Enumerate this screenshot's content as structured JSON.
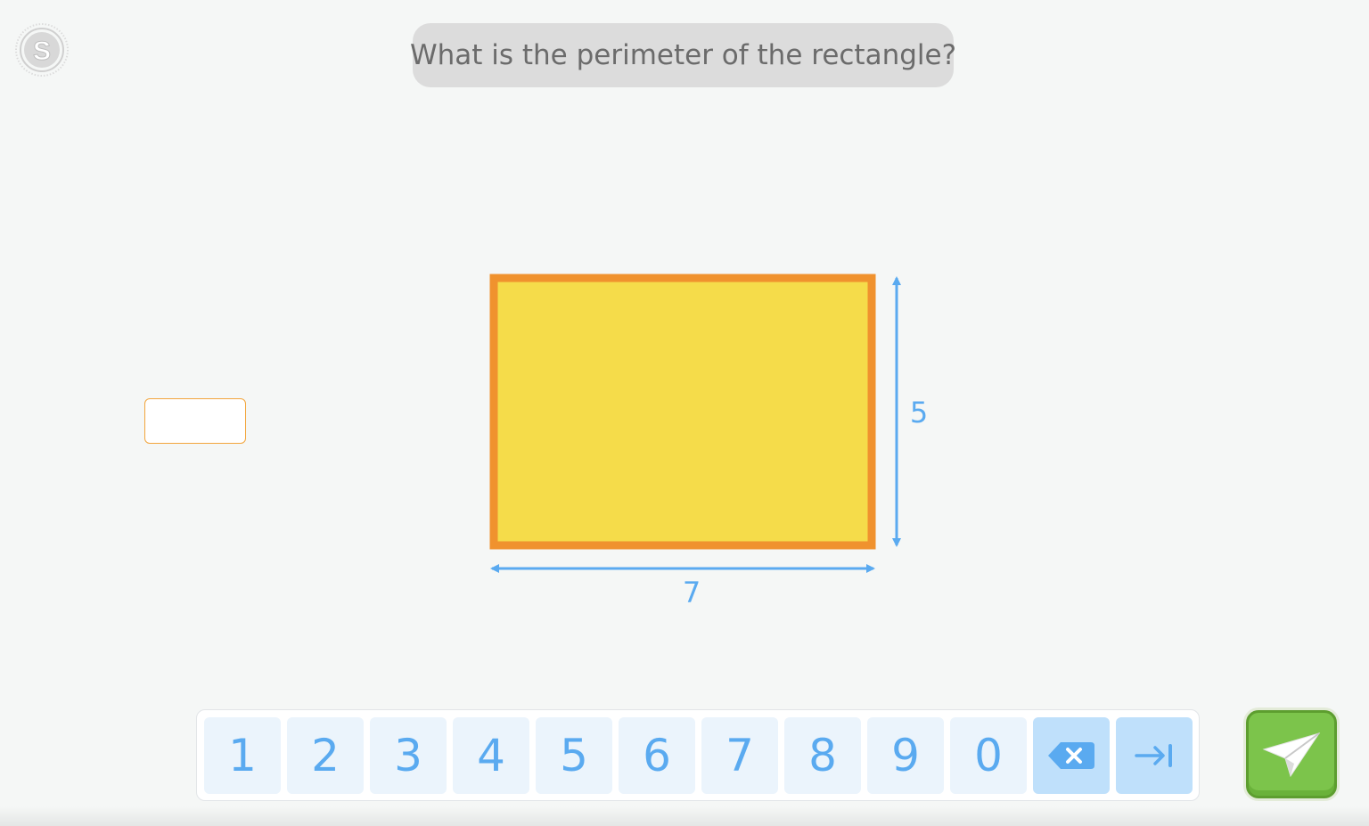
{
  "question": "What is the perimeter of the rectangle?",
  "answer": {
    "value": "",
    "placeholder": ""
  },
  "figure": {
    "width_label": "7",
    "height_label": "5",
    "fill_color": "#f5dc4a",
    "border_color": "#f0922e",
    "arrow_color": "#5aaaf0"
  },
  "keypad": {
    "keys": [
      "1",
      "2",
      "3",
      "4",
      "5",
      "6",
      "7",
      "8",
      "9",
      "0"
    ],
    "backspace_icon": "backspace-icon",
    "tab_icon": "tab-arrow-icon",
    "key_color": "#ebf4fc",
    "action_key_color": "#bfe0fb",
    "digit_color": "#5aaaf0"
  },
  "submit": {
    "icon": "paper-plane-icon",
    "color": "#7cc44b"
  },
  "logo": {
    "letter": "S",
    "icon": "s-logo-icon"
  }
}
